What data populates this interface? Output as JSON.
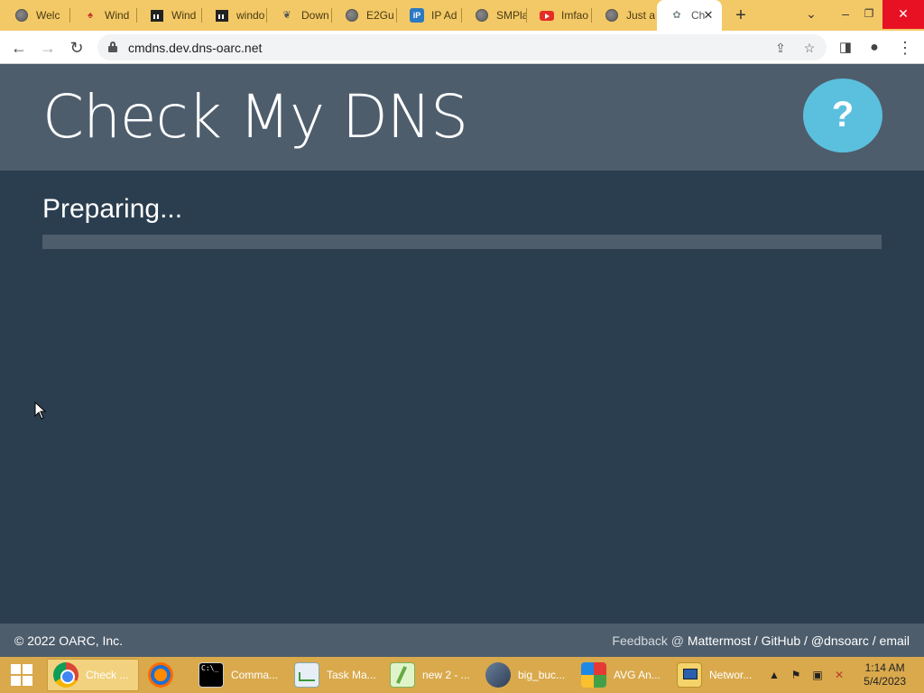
{
  "browser": {
    "tabs": [
      {
        "label": "Welc",
        "icon": "globe-icon"
      },
      {
        "label": "Wind",
        "icon": "cards-icon"
      },
      {
        "label": "Wind",
        "icon": "bank-icon"
      },
      {
        "label": "windo",
        "icon": "bank-icon"
      },
      {
        "label": "Down",
        "icon": "bird-icon"
      },
      {
        "label": "E2Gu",
        "icon": "globe-icon"
      },
      {
        "label": "IP Ad",
        "icon": "ip-icon"
      },
      {
        "label": "SMPla",
        "icon": "globe-icon"
      },
      {
        "label": "Imfao",
        "icon": "youtube-icon"
      },
      {
        "label": "Just a",
        "icon": "globe-icon"
      },
      {
        "label": "Ch",
        "icon": "tree-icon",
        "active": true
      }
    ],
    "new_tab": "+",
    "url": "cmdns.dev.dns-oarc.net"
  },
  "page": {
    "title": "Check My DNS",
    "help_label": "?",
    "status": "Preparing...",
    "progress": 0,
    "colors": {
      "header_bg": "#4e5d6c",
      "main_bg": "#2b3e50",
      "accent": "#5bc0de"
    }
  },
  "footer": {
    "copyright": "© 2022 OARC, Inc.",
    "feedback_prefix": "Feedback @ ",
    "links": [
      "Mattermost",
      "GitHub",
      "@dnsoarc",
      "email"
    ],
    "separator": " / "
  },
  "taskbar": {
    "items": [
      {
        "label": "Check ...",
        "icon": "chrome-icon",
        "active": true
      },
      {
        "label": "",
        "icon": "avast-browser-icon"
      },
      {
        "label": "Comma...",
        "icon": "command-prompt-icon"
      },
      {
        "label": "Task Ma...",
        "icon": "task-manager-icon"
      },
      {
        "label": "new 2 - ...",
        "icon": "notepad-plus-icon"
      },
      {
        "label": "big_buc...",
        "icon": "video-player-icon"
      },
      {
        "label": "AVG An...",
        "icon": "avg-antivirus-icon"
      },
      {
        "label": "Networ...",
        "icon": "network-icon"
      }
    ],
    "clock": {
      "time": "1:14 AM",
      "date": "5/4/2023"
    }
  }
}
